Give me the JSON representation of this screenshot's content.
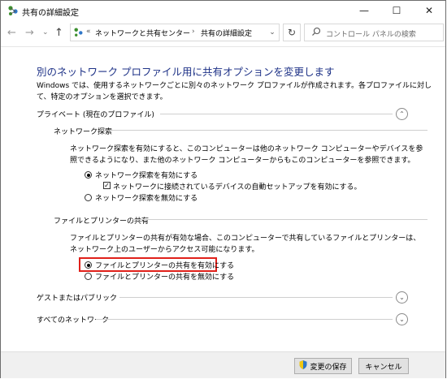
{
  "window": {
    "title": "共有の詳細設定",
    "minimize": "—",
    "maximize": "☐",
    "close": "✕"
  },
  "nav": {
    "back": "←",
    "forward": "→",
    "dropdown": "⌄",
    "up": "↑",
    "breadcrumb_overflow": "«",
    "breadcrumb": [
      "ネットワークと共有センター",
      "共有の詳細設定"
    ],
    "breadcrumb_sep": "›",
    "refresh": "↻",
    "search_placeholder": "コントロール パネルの検索"
  },
  "main": {
    "heading": "別のネットワーク プロファイル用に共有オプションを変更します",
    "description": "Windows では、使用するネットワークごとに別々のネットワーク プロファイルが作成されます。各プロファイルに対して、特定のオプションを選択できます。",
    "private_profile": {
      "label": "プライベート (現在のプロファイル)",
      "network_discovery": {
        "label": "ネットワーク探索",
        "text": "ネットワーク探索を有効にすると、このコンピューターは他のネットワーク コンピューターやデバイスを参照できるようになり、また他のネットワーク コンピューターからもこのコンピューターを参照できます。",
        "option_on": "ネットワーク探索を有効にする",
        "auto_setup": "ネットワークに接続されているデバイスの自動セットアップを有効にする。",
        "option_off": "ネットワーク探索を無効にする"
      },
      "file_printer_sharing": {
        "label": "ファイルとプリンターの共有",
        "text": "ファイルとプリンターの共有が有効な場合、このコンピューターで共有しているファイルとプリンターは、ネットワーク上のユーザーからアクセス可能になります。",
        "option_on": "ファイルとプリンターの共有を有効にする",
        "option_off": "ファイルとプリンターの共有を無効にする"
      }
    },
    "guest_public": "ゲストまたはパブリック",
    "all_networks": "すべてのネットワーク"
  },
  "footer": {
    "save_label": "変更の保存",
    "cancel_label": "キャンセル"
  },
  "colors": {
    "heading": "#1e3287",
    "highlight_border": "#e0201a",
    "footer_bg": "#f0f0f0"
  }
}
